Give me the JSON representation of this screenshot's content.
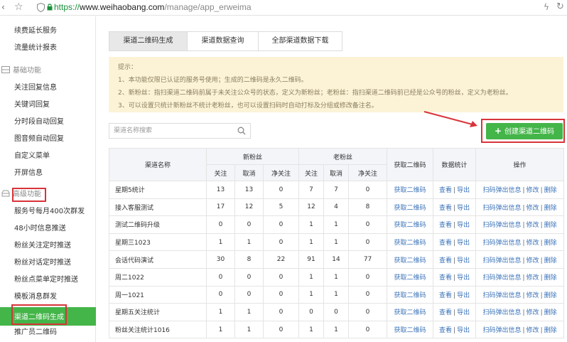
{
  "browser": {
    "url_protocol": "https://",
    "url_host": "www.weihaobang.com",
    "url_path": "/manage/app_erweima",
    "back_glyph": "‹",
    "star_glyph": "☆",
    "flash_glyph": "ϟ",
    "refresh_glyph": "↻"
  },
  "sidebar": {
    "top_items": [
      {
        "label": "续费延长服务"
      },
      {
        "label": "流量统计报表"
      }
    ],
    "group_basic": "基础功能",
    "basic_items": [
      {
        "label": "关注回复信息"
      },
      {
        "label": "关键词回复"
      },
      {
        "label": "分时段自动回复"
      },
      {
        "label": "图音频自动回复"
      },
      {
        "label": "自定义菜单"
      },
      {
        "label": "开屏信息"
      }
    ],
    "group_advanced": "高级功能",
    "advanced_items": [
      {
        "label": "服务号每月400次群发"
      },
      {
        "label": "48小时信息推送"
      },
      {
        "label": "粉丝关注定时推送"
      },
      {
        "label": "粉丝对话定时推送"
      },
      {
        "label": "粉丝点菜单定时推送"
      },
      {
        "label": "模板消息群发"
      }
    ],
    "active_item": "渠道二维码生成",
    "bottom_item": "推广员二维码"
  },
  "tabs": [
    {
      "label": "渠道二维码生成"
    },
    {
      "label": "渠道数据查询"
    },
    {
      "label": "全部渠道数据下载"
    }
  ],
  "notice": {
    "title": "提示：",
    "lines": [
      "1、本功能仅限已认证的服务号使用；生成的二维码是永久二维码。",
      "2、新粉丝：指扫渠道二维码前属于未关注公众号的状态，定义为新粉丝；老粉丝：指扫渠道二维码前已经是公众号的粉丝，定义为老粉丝。",
      "3、可以设置只统计新粉丝不统计老粉丝，也可以设置扫码时自动打标及分组或修改备注名。"
    ]
  },
  "search": {
    "placeholder": "渠道名称搜索",
    "value": ""
  },
  "create_button": {
    "label": "创建渠道二维码",
    "plus": "+"
  },
  "colors": {
    "accent": "#44b549",
    "highlight": "#d9343a",
    "link": "#3a72b8",
    "notice_bg": "#fcf3d7"
  },
  "table": {
    "headers": {
      "name": "渠道名称",
      "new_fans": "新粉丝",
      "old_fans": "老粉丝",
      "follow": "关注",
      "unfollow": "取消",
      "net": "净关注",
      "qrcode": "获取二维码",
      "stats": "数据统计",
      "ops": "操作"
    },
    "link_labels": {
      "get_qr": "获取二维码",
      "view": "查看",
      "export": "导出",
      "scan_popup": "扫码弹出信息",
      "edit": "修改",
      "delete": "删除"
    },
    "rows": [
      {
        "name": "星期5统计",
        "new_follow": "13",
        "new_cancel": "13",
        "new_net": "0",
        "old_follow": "7",
        "old_cancel": "7",
        "old_net": "0"
      },
      {
        "name": "接入客服测试",
        "new_follow": "17",
        "new_cancel": "12",
        "new_net": "5",
        "old_follow": "12",
        "old_cancel": "4",
        "old_net": "8"
      },
      {
        "name": "测试二维码升级",
        "new_follow": "0",
        "new_cancel": "0",
        "new_net": "0",
        "old_follow": "1",
        "old_cancel": "1",
        "old_net": "0"
      },
      {
        "name": "星期三1023",
        "new_follow": "1",
        "new_cancel": "1",
        "new_net": "0",
        "old_follow": "1",
        "old_cancel": "1",
        "old_net": "0"
      },
      {
        "name": "会话代码演试",
        "new_follow": "30",
        "new_cancel": "8",
        "new_net": "22",
        "old_follow": "91",
        "old_cancel": "14",
        "old_net": "77"
      },
      {
        "name": "周二1022",
        "new_follow": "0",
        "new_cancel": "0",
        "new_net": "0",
        "old_follow": "1",
        "old_cancel": "1",
        "old_net": "0"
      },
      {
        "name": "周一1021",
        "new_follow": "0",
        "new_cancel": "0",
        "new_net": "0",
        "old_follow": "1",
        "old_cancel": "1",
        "old_net": "0"
      },
      {
        "name": "星期五关注统计",
        "new_follow": "1",
        "new_cancel": "1",
        "new_net": "0",
        "old_follow": "0",
        "old_cancel": "0",
        "old_net": "0"
      },
      {
        "name": "粉丝关注统计1016",
        "new_follow": "1",
        "new_cancel": "1",
        "new_net": "0",
        "old_follow": "1",
        "old_cancel": "1",
        "old_net": "0"
      }
    ]
  }
}
